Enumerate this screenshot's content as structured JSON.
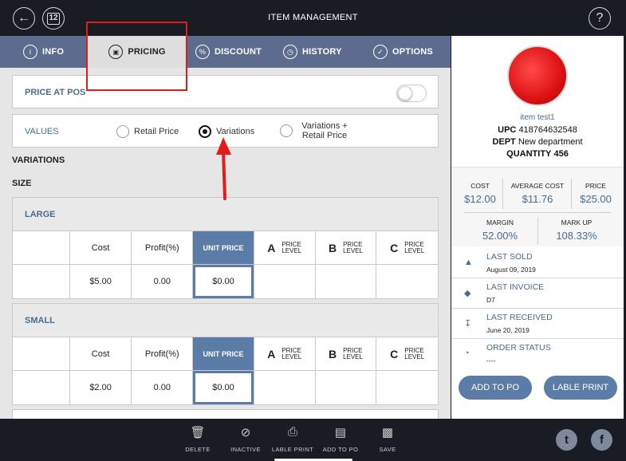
{
  "header": {
    "title": "ITEM MANAGEMENT",
    "calendar_day": "12"
  },
  "tabs": [
    {
      "label": "INFO",
      "icon": "info-icon"
    },
    {
      "label": "PRICING",
      "icon": "pricing-icon"
    },
    {
      "label": "DISCOUNT",
      "icon": "percent-icon"
    },
    {
      "label": "HISTORY",
      "icon": "clock-icon"
    },
    {
      "label": "OPTIONS",
      "icon": "check-circle-icon"
    }
  ],
  "pricing": {
    "price_at_pos_label": "PRICE AT POS",
    "price_at_pos_on": false,
    "values_label": "VALUES",
    "value_options": [
      "Retail Price",
      "Variations",
      "Variations + Retail Price"
    ],
    "selected_value": "Variations",
    "variations_label": "VARIATIONS",
    "size_label": "SIZE",
    "columns": {
      "cost": "Cost",
      "profit": "Profit(%)",
      "unit_price": "UNIT PRICE",
      "levels": [
        {
          "letter": "A",
          "text1": "PRICE",
          "text2": "LEVEL"
        },
        {
          "letter": "B",
          "text1": "PRICE",
          "text2": "LEVEL"
        },
        {
          "letter": "C",
          "text1": "PRICE",
          "text2": "LEVEL"
        }
      ]
    },
    "variations": [
      {
        "name": "LARGE",
        "cost": "$5.00",
        "profit": "0.00",
        "unit_price": "$0.00"
      },
      {
        "name": "SMALL",
        "cost": "$2.00",
        "profit": "0.00",
        "unit_price": "$0.00"
      }
    ]
  },
  "item": {
    "name": "item test1",
    "upc_label": "UPC",
    "upc": "418764632548",
    "dept_label": "DEPT",
    "dept": "New department",
    "qty_label": "QUANTITY",
    "qty": "456"
  },
  "stats": {
    "cost_label": "COST",
    "cost": "$12.00",
    "avg_cost_label": "AVERAGE COST",
    "avg_cost": "$11.76",
    "price_label": "PRICE",
    "price": "$25.00",
    "margin_label": "MARGIN",
    "margin": "52.00%",
    "markup_label": "MARK UP",
    "markup": "108.33%"
  },
  "info_rows": [
    {
      "title": "LAST SOLD",
      "sub": "August 09, 2019",
      "icon": "bag-icon"
    },
    {
      "title": "LAST INVOICE",
      "sub": "D7",
      "icon": "layers-icon"
    },
    {
      "title": "LAST RECEIVED",
      "sub": "June 20, 2019",
      "icon": "tray-download-icon"
    },
    {
      "title": "ORDER STATUS",
      "sub": "----",
      "icon": "pie-icon"
    }
  ],
  "actions": {
    "add_to_po": "ADD TO PO",
    "label_print": "LABLE PRINT"
  },
  "toolbar": [
    {
      "label": "DELETE",
      "icon": "trash-icon"
    },
    {
      "label": "INACTIVE",
      "icon": "inactive-icon"
    },
    {
      "label": "LABLE PRINT",
      "icon": "printer-icon"
    },
    {
      "label": "ADD TO PO",
      "icon": "document-icon"
    },
    {
      "label": "SAVE",
      "icon": "save-icon"
    }
  ],
  "colors": {
    "tab_bar": "#5c6c8e",
    "accent": "#5b7ca6",
    "highlight": "#e41b1b",
    "dark": "#1a1c24"
  }
}
